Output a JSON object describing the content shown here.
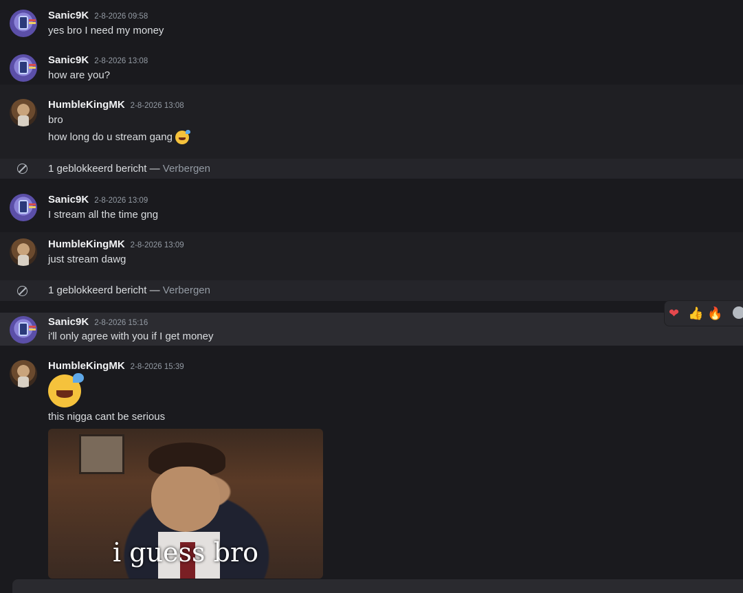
{
  "messages": [
    {
      "author": "Sanic9K",
      "timestamp": "2-8-2026 09:58",
      "lines": [
        "yes bro I need my money"
      ]
    },
    {
      "author": "Sanic9K",
      "timestamp": "2-8-2026 13:08",
      "lines": [
        "how are you?"
      ]
    },
    {
      "author": "HumbleKingMK",
      "timestamp": "2-8-2026 13:08",
      "lines": [
        "bro",
        "how long do u stream gang"
      ]
    },
    {
      "author": "Sanic9K",
      "timestamp": "2-8-2026 13:09",
      "lines": [
        "I stream all the time gng"
      ]
    },
    {
      "author": "HumbleKingMK",
      "timestamp": "2-8-2026 13:09",
      "lines": [
        "just stream dawg"
      ]
    },
    {
      "author": "Sanic9K",
      "timestamp": "2-8-2026 15:16",
      "lines": [
        "i'll only agree with you if I get money"
      ]
    },
    {
      "author": "HumbleKingMK",
      "timestamp": "2-8-2026 15:39",
      "lines": [
        "this nigga cant be serious"
      ]
    }
  ],
  "blocked": {
    "text": "1 geblokkeerd bericht — ",
    "action": "Verbergen"
  },
  "gif": {
    "caption": "i guess bro"
  },
  "reactions": [
    {
      "icon": "heart-icon",
      "glyph": "❤"
    },
    {
      "icon": "thumbs-up-icon",
      "glyph": "👍"
    },
    {
      "icon": "fire-icon",
      "glyph": "🔥"
    }
  ],
  "colors": {
    "background": "#1a1a1e",
    "username": "#f2f3f5",
    "timestamp": "#949ba4",
    "text": "#dbdee1"
  }
}
